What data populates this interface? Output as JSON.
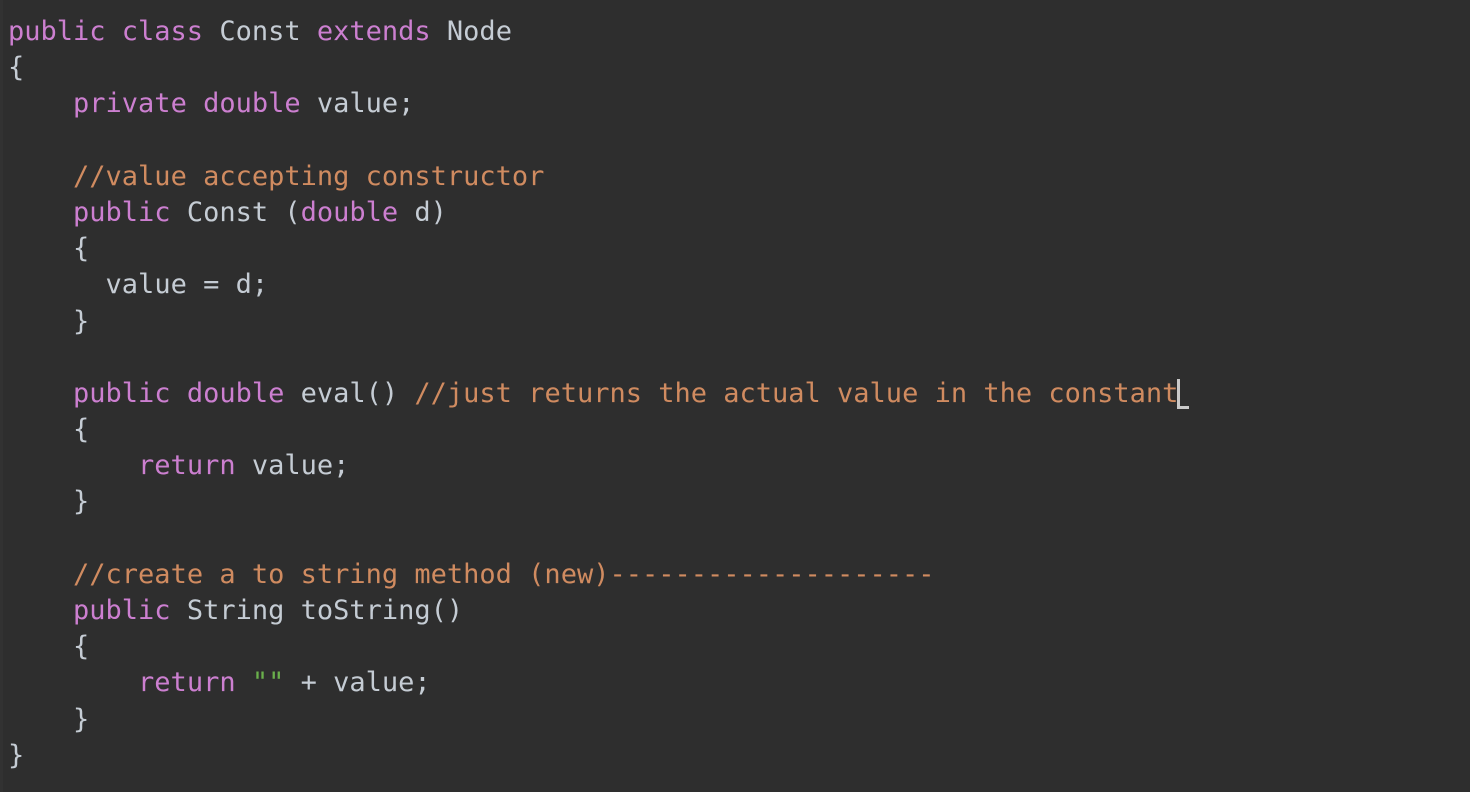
{
  "editor": {
    "background_color": "#2e2e2e",
    "language": "Java",
    "font_size_px": 27,
    "line_height_px": 36,
    "colors": {
      "keyword": "#cc7fd0",
      "comment": "#d08b60",
      "identifier": "#c5ccd4",
      "string": "#6ab04c",
      "caret": "#c9c9c9",
      "background": "#2e2e2e"
    },
    "caret": {
      "visible": true,
      "line_index": 10,
      "after_text": "constant"
    },
    "lines": [
      {
        "index": 0,
        "indent": "",
        "tokens": [
          {
            "type": "keyword",
            "text": "public class "
          },
          {
            "type": "identifier",
            "text": "Const "
          },
          {
            "type": "keyword",
            "text": "extends "
          },
          {
            "type": "identifier",
            "text": "Node"
          }
        ]
      },
      {
        "index": 1,
        "indent": "",
        "tokens": [
          {
            "type": "identifier",
            "text": "{"
          }
        ]
      },
      {
        "index": 2,
        "indent": "    ",
        "tokens": [
          {
            "type": "keyword",
            "text": "private double "
          },
          {
            "type": "identifier",
            "text": "value;"
          }
        ]
      },
      {
        "index": 3,
        "indent": "",
        "tokens": []
      },
      {
        "index": 4,
        "indent": "    ",
        "tokens": [
          {
            "type": "comment",
            "text": "//value accepting constructor"
          }
        ]
      },
      {
        "index": 5,
        "indent": "    ",
        "tokens": [
          {
            "type": "keyword",
            "text": "public "
          },
          {
            "type": "identifier",
            "text": "Const ("
          },
          {
            "type": "keyword",
            "text": "double "
          },
          {
            "type": "identifier",
            "text": "d)"
          }
        ]
      },
      {
        "index": 6,
        "indent": "    ",
        "tokens": [
          {
            "type": "identifier",
            "text": "{"
          }
        ]
      },
      {
        "index": 7,
        "indent": "      ",
        "tokens": [
          {
            "type": "identifier",
            "text": "value = d;"
          }
        ]
      },
      {
        "index": 8,
        "indent": "    ",
        "tokens": [
          {
            "type": "identifier",
            "text": "}"
          }
        ]
      },
      {
        "index": 9,
        "indent": "",
        "tokens": []
      },
      {
        "index": 10,
        "indent": "    ",
        "tokens": [
          {
            "type": "keyword",
            "text": "public double "
          },
          {
            "type": "identifier",
            "text": "eval() "
          },
          {
            "type": "comment",
            "text": "//just returns the actual value in the constant"
          }
        ]
      },
      {
        "index": 11,
        "indent": "    ",
        "tokens": [
          {
            "type": "identifier",
            "text": "{"
          }
        ]
      },
      {
        "index": 12,
        "indent": "        ",
        "tokens": [
          {
            "type": "keyword",
            "text": "return "
          },
          {
            "type": "identifier",
            "text": "value;"
          }
        ]
      },
      {
        "index": 13,
        "indent": "    ",
        "tokens": [
          {
            "type": "identifier",
            "text": "}"
          }
        ]
      },
      {
        "index": 14,
        "indent": "",
        "tokens": []
      },
      {
        "index": 15,
        "indent": "    ",
        "tokens": [
          {
            "type": "comment",
            "text": "//create a to string method (new)--------------------"
          }
        ]
      },
      {
        "index": 16,
        "indent": "    ",
        "tokens": [
          {
            "type": "keyword",
            "text": "public "
          },
          {
            "type": "identifier",
            "text": "String toString()"
          }
        ]
      },
      {
        "index": 17,
        "indent": "    ",
        "tokens": [
          {
            "type": "identifier",
            "text": "{"
          }
        ]
      },
      {
        "index": 18,
        "indent": "        ",
        "tokens": [
          {
            "type": "keyword",
            "text": "return "
          },
          {
            "type": "string",
            "text": "\"\""
          },
          {
            "type": "identifier",
            "text": " + value;"
          }
        ]
      },
      {
        "index": 19,
        "indent": "    ",
        "tokens": [
          {
            "type": "identifier",
            "text": "}"
          }
        ]
      },
      {
        "index": 20,
        "indent": "",
        "tokens": [
          {
            "type": "identifier",
            "text": "}"
          }
        ]
      }
    ]
  }
}
